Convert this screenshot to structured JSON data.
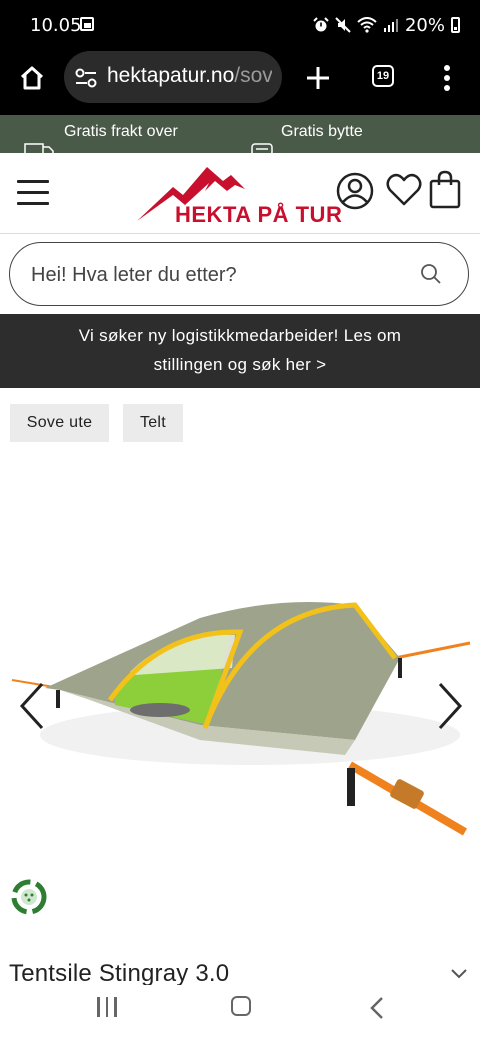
{
  "status_bar": {
    "time": "10.05",
    "battery_percent": "20%",
    "icons": [
      "gallery-icon",
      "alarm-icon",
      "mute-icon",
      "wifi-icon",
      "signal-icon",
      "battery-icon"
    ]
  },
  "browser": {
    "url_domain": "hektapatur.no",
    "url_path": "/sov",
    "tab_count": "19"
  },
  "promo": {
    "items": [
      "Gratis frakt over",
      "Gratis bytte"
    ]
  },
  "header": {
    "logo_text": "HEKTA PÅ TUR",
    "brand_color": "#c8102e"
  },
  "search": {
    "placeholder": "Hei! Hva leter du etter?"
  },
  "announcement": {
    "line1": "Vi søker ny logistikkmedarbeider! Les om",
    "line2": "stillingen og søk her >"
  },
  "tags": [
    "Sove ute",
    "Telt"
  ],
  "product": {
    "image": "hanging-tree-tent-image",
    "title": "Tentsile Stingray 3.0",
    "eco_badge": "recycle-icon"
  },
  "colors": {
    "promo_bg": "#4a5a48",
    "announcement_bg": "#2d2d2d",
    "tent_green": "#8ccf3a",
    "tent_yellow": "#f2c21b",
    "strap_orange": "#f0821e"
  }
}
